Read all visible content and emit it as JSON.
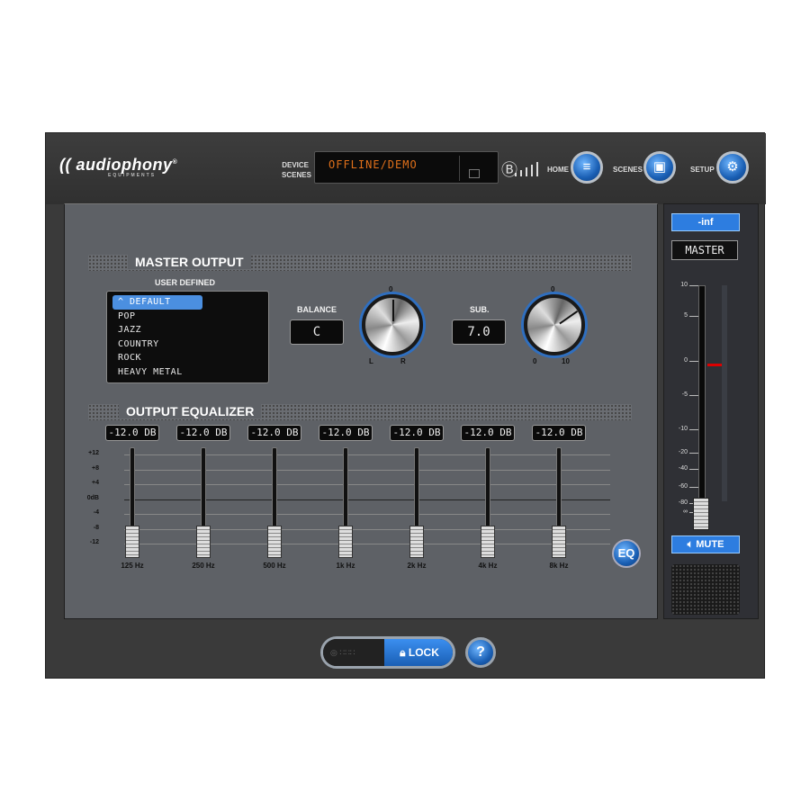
{
  "brand": {
    "name": "audiophony",
    "registered": "®",
    "subtitle": "EQUIPMENTS"
  },
  "header": {
    "device_label": "DEVICE",
    "scenes_label": "SCENES",
    "display_text": "OFFLINE/DEMO",
    "nav": [
      {
        "label": "HOME",
        "icon": "sliders-icon"
      },
      {
        "label": "SCENES",
        "icon": "save-icon"
      },
      {
        "label": "SETUP",
        "icon": "gear-icon"
      }
    ]
  },
  "master_output": {
    "title": "MASTER OUTPUT",
    "presets_label": "USER DEFINED",
    "presets": [
      "^ DEFAULT",
      "POP",
      "JAZZ",
      "COUNTRY",
      "ROCK",
      "HEAVY METAL"
    ],
    "selected_preset_index": 0,
    "balance": {
      "label": "BALANCE",
      "value": "C",
      "min_label": "L",
      "max_label": "R",
      "top_label": "0"
    },
    "sub": {
      "label": "SUB.",
      "value": "7.0",
      "min_label": "0",
      "max_label": "10",
      "top_label": "0"
    }
  },
  "equalizer": {
    "title": "OUTPUT EQUALIZER",
    "scale": [
      "+12",
      "+8",
      "+4",
      "0dB",
      "-4",
      "-8",
      "-12"
    ],
    "bands": [
      {
        "freq": "125 Hz",
        "gain": "-12.0 DB"
      },
      {
        "freq": "250 Hz",
        "gain": "-12.0 DB"
      },
      {
        "freq": "500 Hz",
        "gain": "-12.0 DB"
      },
      {
        "freq": "1k Hz",
        "gain": "-12.0 DB"
      },
      {
        "freq": "2k Hz",
        "gain": "-12.0 DB"
      },
      {
        "freq": "4k Hz",
        "gain": "-12.0 DB"
      },
      {
        "freq": "8k Hz",
        "gain": "-12.0 DB"
      }
    ],
    "eq_button": "EQ"
  },
  "master_fader": {
    "level": "-inf",
    "label": "MASTER",
    "scale": [
      "10",
      "5",
      "0",
      "-5",
      "-10",
      "-20",
      "-40",
      "-60",
      "-80",
      "∞"
    ],
    "mute_label": "MUTE"
  },
  "footer": {
    "lock_label": "LOCK",
    "help_label": "?"
  }
}
